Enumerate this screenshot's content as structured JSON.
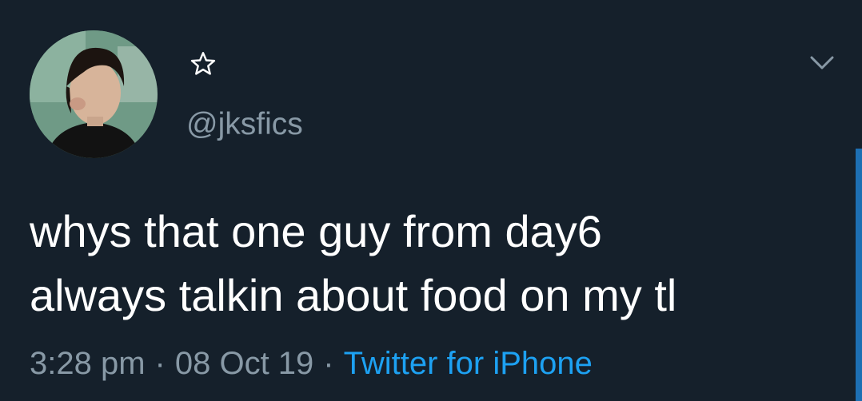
{
  "profile": {
    "handle": "@jksfics",
    "avatar_icon": "profile-photo-icon",
    "star_icon": "star-outline-icon"
  },
  "header": {
    "menu_icon": "chevron-down-icon"
  },
  "tweet": {
    "lines": [
      "whys that one guy from day6",
      "always talkin about food on my tl"
    ]
  },
  "meta": {
    "time": "3:28 pm",
    "separator": "·",
    "date": "08 Oct 19",
    "source": "Twitter for iPhone"
  },
  "colors": {
    "background": "#15202b",
    "text": "#ffffff",
    "secondary_text": "#8899a6",
    "link": "#1da1f2",
    "scroll_indicator": "#1d6fb3"
  }
}
